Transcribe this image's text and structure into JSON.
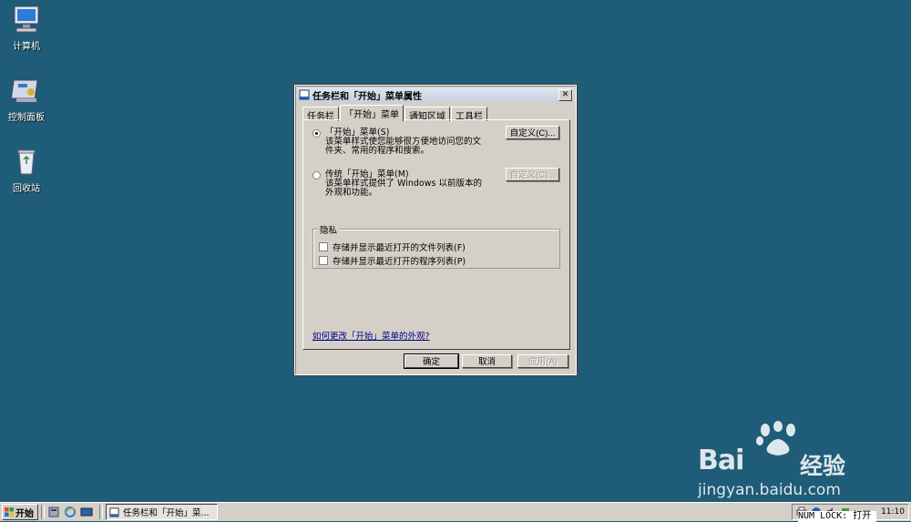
{
  "desktop": {
    "icons": [
      {
        "label": "计算机"
      },
      {
        "label": "控制面板"
      },
      {
        "label": "回收站"
      }
    ]
  },
  "dialog": {
    "title": "任务栏和「开始」菜单属性",
    "close_glyph": "✕",
    "tabs": [
      {
        "label": "任务栏"
      },
      {
        "label": "「开始」菜单"
      },
      {
        "label": "通知区域"
      },
      {
        "label": "工具栏"
      }
    ],
    "active_tab": 1,
    "start_menu_option": {
      "label": "「开始」菜单(S)",
      "description": "该菜单样式使您能够很方便地访问您的文件夹、常用的程序和搜索。",
      "selected": true,
      "customize_label": "自定义(C)..."
    },
    "classic_option": {
      "label": "传统「开始」菜单(M)",
      "description": "该菜单样式提供了 Windows 以前版本的外观和功能。",
      "selected": false,
      "customize_label": "自定义(C)..."
    },
    "privacy": {
      "legend": "隐私",
      "files_label": "存储并显示最近打开的文件列表(F)",
      "programs_label": "存储并显示最近打开的程序列表(P)",
      "files_checked": false,
      "programs_checked": false
    },
    "help_link": "如何更改「开始」菜单的外观?",
    "ok_label": "确定",
    "cancel_label": "取消",
    "apply_label": "应用(A)"
  },
  "taskbar": {
    "start_label": "开始",
    "task_label": "任务栏和「开始」菜...",
    "clock": "11:10"
  },
  "status_overlay": "NUM LOCK: 打开",
  "watermark": {
    "brand": "Bai",
    "brand_cn": "经验",
    "url": "jingyan.baidu.com"
  },
  "colors": {
    "desktop": "#1f5c78",
    "dialog_face": "#d4d0c8",
    "link": "#000080"
  }
}
